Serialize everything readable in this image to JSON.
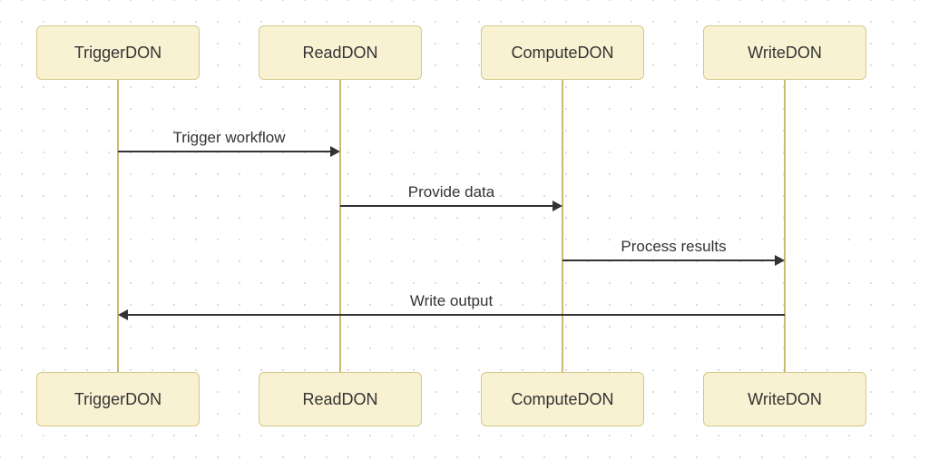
{
  "participants": {
    "p1": "TriggerDON",
    "p2": "ReadDON",
    "p3": "ComputeDON",
    "p4": "WriteDON"
  },
  "messages": {
    "m1": "Trigger workflow",
    "m2": "Provide data",
    "m3": "Process results",
    "m4": "Write output"
  },
  "colors": {
    "box_fill": "#f9f2d2",
    "box_border": "#d4c88a",
    "lifeline": "#c9bc6e",
    "arrow": "#333333"
  }
}
